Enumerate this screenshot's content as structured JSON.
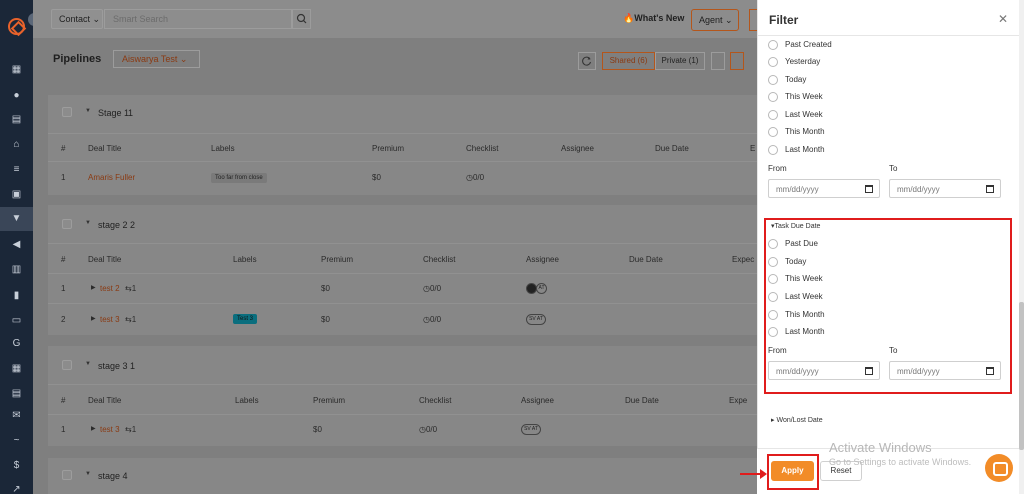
{
  "topbar": {
    "contact_dropdown": "Contact",
    "search_placeholder": "Smart Search",
    "whats_new": "What's New",
    "agent_dropdown": "Agent"
  },
  "pipelines": {
    "title": "Pipelines",
    "selected": "Aiswarya Test",
    "shared_label": "Shared (6)",
    "private_label": "Private (1)"
  },
  "stages": [
    {
      "name": "Stage 1",
      "count": "1",
      "columns": [
        "#",
        "Deal Title",
        "Labels",
        "Premium",
        "Checklist",
        "Assignee",
        "Due Date",
        "E"
      ],
      "rows": [
        {
          "num": "1",
          "title": "Amaris Fuller",
          "label": "Too far from close",
          "premium": "$0",
          "checklist": "0/0"
        }
      ]
    },
    {
      "name": "stage 2",
      "count": "2",
      "columns": [
        "#",
        "Deal Title",
        "Labels",
        "Premium",
        "Checklist",
        "Assignee",
        "Due Date",
        "Expec"
      ],
      "rows": [
        {
          "num": "1",
          "title": "test 2",
          "sub": "1",
          "label": "",
          "premium": "$0",
          "checklist": "0/0",
          "assignee": "AT"
        },
        {
          "num": "2",
          "title": "test 3",
          "sub": "1",
          "label": "Test 3",
          "premium": "$0",
          "checklist": "0/0",
          "assignee": "SV AT"
        }
      ]
    },
    {
      "name": "stage 3",
      "count": "1",
      "columns": [
        "#",
        "Deal Title",
        "Labels",
        "Premium",
        "Checklist",
        "Assignee",
        "Due Date",
        "Expe"
      ],
      "rows": [
        {
          "num": "1",
          "title": "test 3",
          "sub": "1",
          "label": "",
          "premium": "$0",
          "checklist": "0/0",
          "assignee": "SV AT"
        }
      ]
    },
    {
      "name": "stage 4",
      "count": "",
      "columns": [],
      "rows": []
    }
  ],
  "filter": {
    "title": "Filter",
    "created_options": [
      "Past Created",
      "Yesterday",
      "Today",
      "This Week",
      "Last Week",
      "This Month",
      "Last Month"
    ],
    "from_label": "From",
    "to_label": "To",
    "date_placeholder": "mm/dd/yyyy",
    "task_due_title": "Task Due Date",
    "task_due_options": [
      "Past Due",
      "Today",
      "This Week",
      "Last Week",
      "This Month",
      "Last Month"
    ],
    "won_lost_title": "Won/Lost Date",
    "apply_label": "Apply",
    "reset_label": "Reset"
  },
  "overlay": {
    "activate_title": "Activate Windows",
    "activate_sub": "Go to Settings to activate Windows."
  },
  "colors": {
    "accent": "#f28c28",
    "highlight": "#e01c1c",
    "nav_bg": "#1b2738"
  }
}
